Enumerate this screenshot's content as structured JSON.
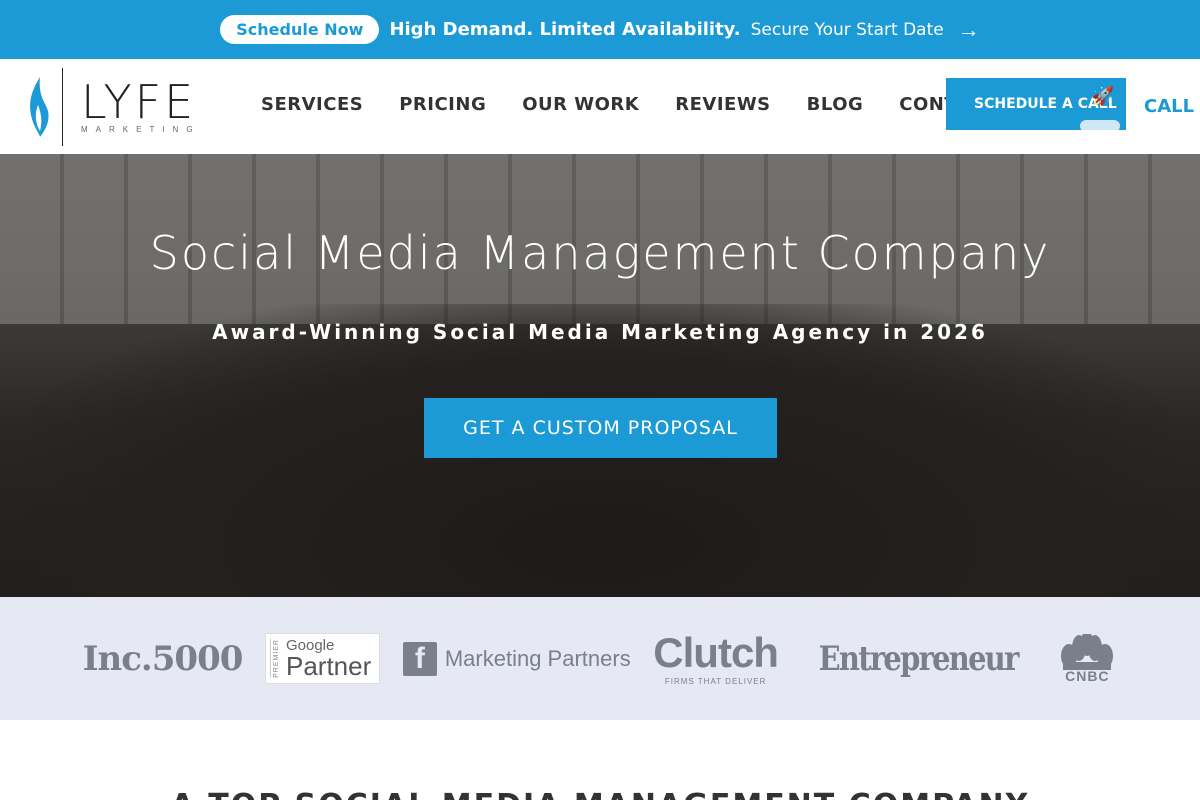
{
  "promo": {
    "pill_label": "Schedule Now",
    "headline": "High Demand. Limited Availability.",
    "cta_text": "Secure Your Start Date",
    "arrow": "→"
  },
  "header": {
    "logo": {
      "name": "LYFE",
      "sub": "MARKETING"
    },
    "nav": [
      "SERVICES",
      "PRICING",
      "OUR WORK",
      "REVIEWS",
      "BLOG",
      "CONTACT"
    ],
    "cta_label": "SCHEDULE A CALL",
    "call_label": "CALL US"
  },
  "hero": {
    "title": "Social Media Management Company",
    "subtitle": "Award-Winning Social Media Marketing Agency in 2026",
    "button_label": "GET A CUSTOM PROPOSAL"
  },
  "partners": {
    "inc": "Inc.5000",
    "google_premier": "PREMIER",
    "google_top": "Google",
    "google_bottom": "Partner",
    "facebook": "Marketing Partners",
    "clutch": "Clutch",
    "clutch_sub": "FIRMS THAT DELIVER",
    "entrepreneur": "Entrepreneur",
    "cnbc": "CNBC"
  },
  "bottom": {
    "heading": "A TOP SOCIAL MEDIA MANAGEMENT COMPANY"
  },
  "colors": {
    "brand_blue": "#1c9ad6",
    "partner_bg": "#e6e9f4",
    "partner_gray": "#7a7f8c"
  }
}
